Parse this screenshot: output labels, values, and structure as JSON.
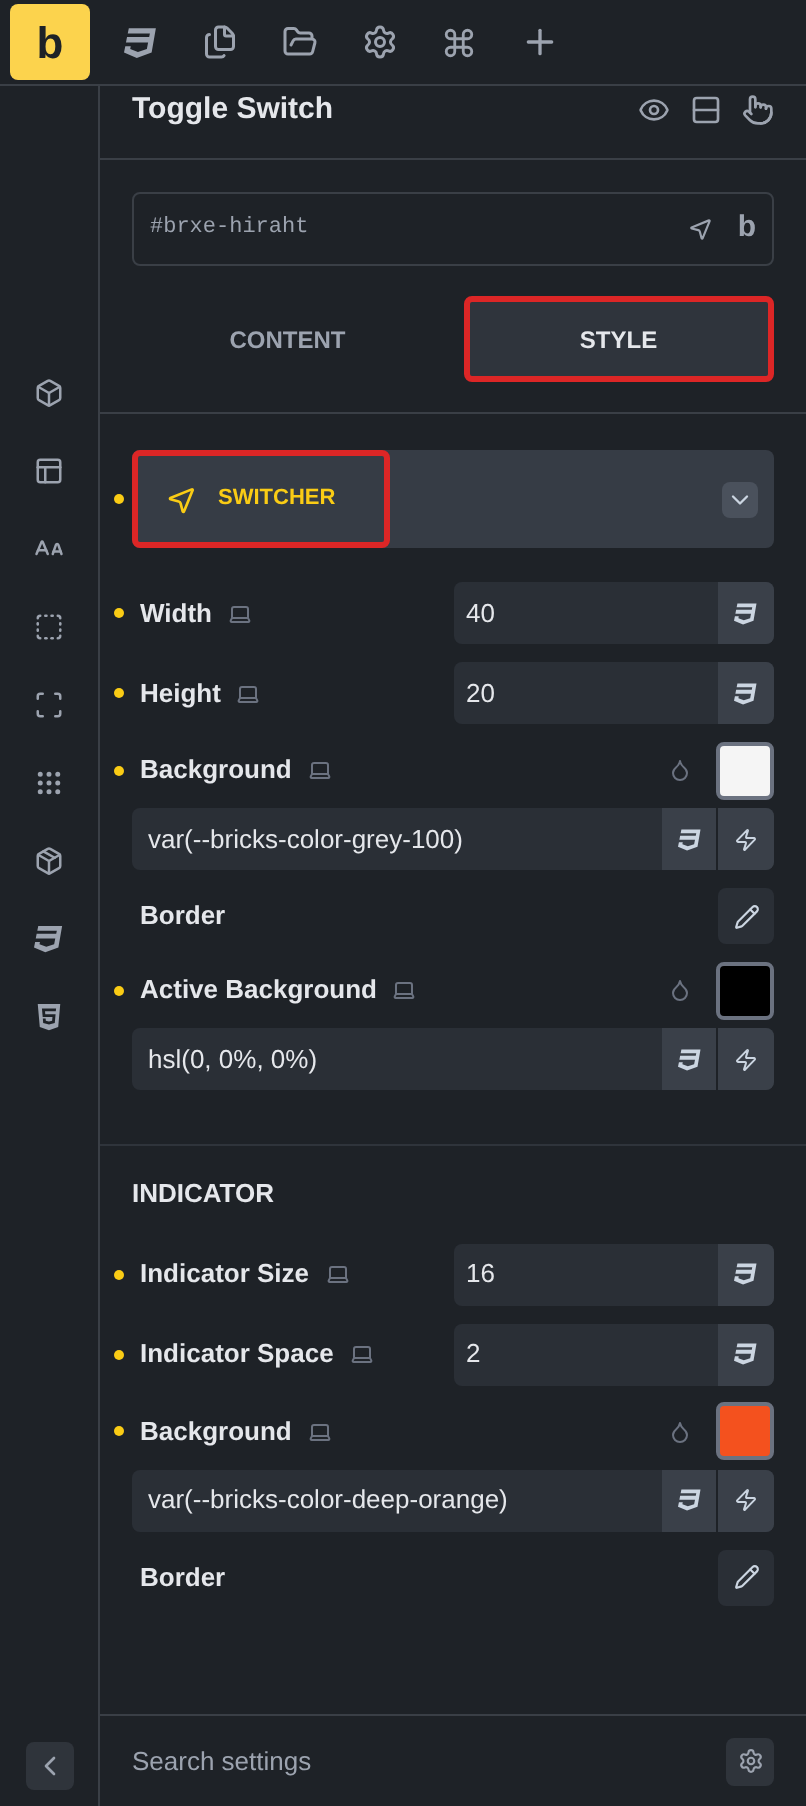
{
  "logo": "b",
  "header": {
    "title": "Toggle Switch"
  },
  "element_id": {
    "value": "#brxe-hiraht",
    "badge": "b"
  },
  "tabs": [
    {
      "label": "CONTENT",
      "selected": false,
      "highlighted": false
    },
    {
      "label": "STYLE",
      "selected": true,
      "highlighted": true
    }
  ],
  "sections": [
    {
      "kind": "group",
      "title": "SWITCHER",
      "modified": true,
      "highlighted": true,
      "controls": [
        {
          "kind": "number",
          "label": "Width",
          "modified": true,
          "value": "40"
        },
        {
          "kind": "number",
          "label": "Height",
          "modified": true,
          "value": "20"
        },
        {
          "kind": "color",
          "label": "Background",
          "modified": true,
          "color": "#f5f5f5",
          "value": "var(--bricks-color-grey-100)"
        },
        {
          "kind": "border",
          "label": "Border",
          "modified": false
        },
        {
          "kind": "color",
          "label": "Active Background",
          "modified": true,
          "color": "#000000",
          "value": "hsl(0, 0%, 0%)"
        }
      ]
    },
    {
      "kind": "heading",
      "title": "INDICATOR",
      "controls": [
        {
          "kind": "number",
          "label": "Indicator Size",
          "modified": true,
          "value": "16"
        },
        {
          "kind": "number",
          "label": "Indicator Space",
          "modified": true,
          "value": "2"
        },
        {
          "kind": "color",
          "label": "Background",
          "modified": true,
          "color": "#f4511e",
          "value": "var(--bricks-color-deep-orange)"
        },
        {
          "kind": "border",
          "label": "Border",
          "modified": false
        }
      ]
    }
  ],
  "footer": {
    "search": {
      "placeholder": "Search settings"
    }
  }
}
